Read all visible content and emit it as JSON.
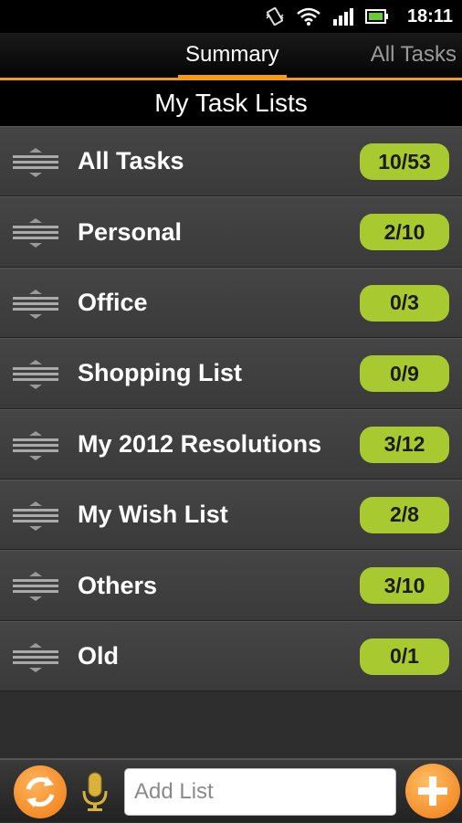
{
  "status_bar": {
    "time": "18:11",
    "icons": [
      "vibrate-icon",
      "wifi-icon",
      "signal-icon",
      "battery-icon"
    ]
  },
  "tabs": [
    {
      "label": "Summary",
      "active": true
    },
    {
      "label": "All Tasks",
      "active": false
    }
  ],
  "header": {
    "title": "My Task Lists"
  },
  "task_lists": [
    {
      "name": "All Tasks",
      "count": "10/53"
    },
    {
      "name": "Personal",
      "count": "2/10"
    },
    {
      "name": "Office",
      "count": "0/3"
    },
    {
      "name": "Shopping List",
      "count": "0/9"
    },
    {
      "name": "My 2012 Resolutions",
      "count": "3/12"
    },
    {
      "name": "My Wish List",
      "count": "2/8"
    },
    {
      "name": "Others",
      "count": "3/10"
    },
    {
      "name": "Old",
      "count": "0/1"
    }
  ],
  "bottom_bar": {
    "add_list_placeholder": "Add List",
    "icons": [
      "refresh-icon",
      "microphone-icon",
      "plus-icon"
    ]
  },
  "colors": {
    "accent": "#f39a1c",
    "badge": "#a8c92f",
    "row_bg": "#414141",
    "header_bg": "#000000"
  }
}
